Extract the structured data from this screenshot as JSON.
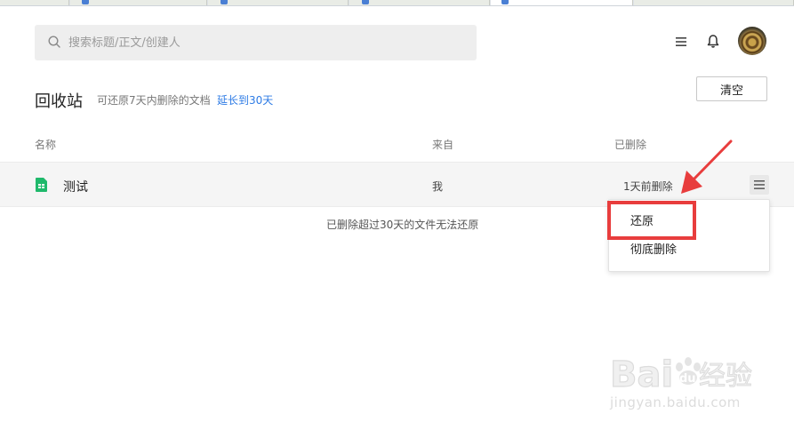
{
  "search": {
    "placeholder": "搜索标题/正文/创建人"
  },
  "header": {
    "icons": [
      "menu-icon",
      "bell-icon",
      "avatar"
    ]
  },
  "page": {
    "title": "回收站",
    "subtitle": "可还原7天内删除的文档",
    "extend_link": "延长到30天",
    "clear_button": "清空"
  },
  "columns": {
    "name": "名称",
    "source": "来自",
    "deleted": "已删除"
  },
  "files": [
    {
      "name": "测试",
      "source": "我",
      "deleted": "1天前删除",
      "icon": "spreadsheet-icon"
    }
  ],
  "footer_note": "已删除超过30天的文件无法还原",
  "context_menu": {
    "restore": "还原",
    "delete_permanently": "彻底删除"
  },
  "watermark": {
    "logo_text": "Baidu经验",
    "domain": "jingyan.baidu.com"
  },
  "colors": {
    "link": "#2d7be5",
    "sheet_green": "#1fb96b",
    "annotation_red": "#e83d3d"
  }
}
